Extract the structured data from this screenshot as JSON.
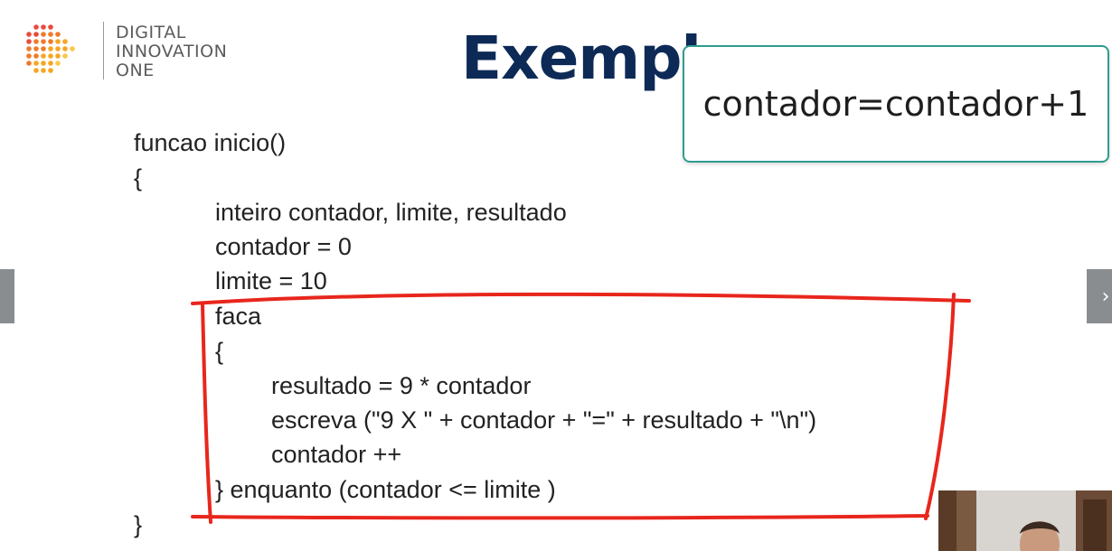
{
  "logo": {
    "lines": [
      "DIGITAL",
      "INNOVATION",
      "ONE"
    ],
    "dot_colors": [
      "#e94b3c",
      "#f07a2b",
      "#f5a623",
      "#f7c84a"
    ]
  },
  "slide": {
    "title": "Exempl",
    "callout": "contador=contador+1"
  },
  "code": {
    "lines": [
      "funcao inicio()",
      "{",
      "inteiro contador, limite, resultado",
      "contador = 0",
      "limite = 10",
      "faca",
      "{",
      "resultado = 9 * contador",
      "escreva (\"9 X \" + contador + \"=\" + resultado + \"\\n\")",
      "contador ++",
      "} enquanto (contador <= limite )",
      "}"
    ]
  },
  "navigation": {
    "next_icon": "chevron-right-icon",
    "prev_icon": "chevron-left-icon",
    "next_glyph": "›"
  },
  "annotation": {
    "color": "#e8261c"
  }
}
